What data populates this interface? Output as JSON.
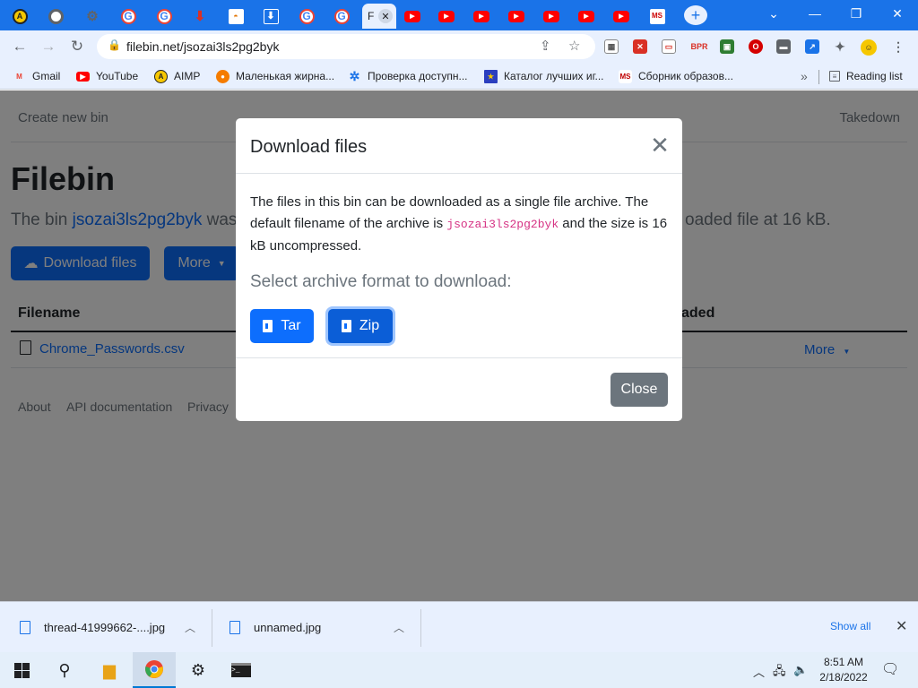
{
  "browser": {
    "active_tab_label": "F",
    "url": "filebin.net/jsozai3ls2pg2byk",
    "tab_icons": [
      "aimp-icon",
      "chromium-icon",
      "gear-icon",
      "google-icon",
      "google-icon",
      "red-arrow-icon",
      "image-icon",
      "download-icon",
      "google-icon",
      "google-icon"
    ],
    "youtube_tab_count": 7,
    "bookmarks": [
      {
        "label": "Gmail",
        "icon": "gmail-icon",
        "color": "#ea4335"
      },
      {
        "label": "YouTube",
        "icon": "youtube-icon",
        "color": "#ff0000"
      },
      {
        "label": "AIMP",
        "icon": "aimp-icon",
        "color": "#f6c700"
      },
      {
        "label": "Маленькая жирна...",
        "icon": "flame-icon",
        "color": "#f57c00"
      },
      {
        "label": "Проверка доступн...",
        "icon": "gear-icon",
        "color": "#1a73e8"
      },
      {
        "label": "Каталог лучших иг...",
        "icon": "flag-icon",
        "color": "#2b3fbf"
      },
      {
        "label": "Сборник образов...",
        "icon": "ms-icon",
        "color": "#c00000"
      }
    ],
    "reading_list": "Reading list"
  },
  "page": {
    "nav_left": "Create new bin",
    "nav_right": "Takedown",
    "title": "Filebin",
    "lead_prefix": "The bin",
    "bin_id": "jsozai3ls2pg2byk",
    "lead_after": "was",
    "lead_right": "oaded file at 16 kB.",
    "download_button": "Download files",
    "more_button": "More",
    "col_filename": "Filename",
    "col_uploaded": "aded",
    "file_name": "Chrome_Passwords.csv",
    "row_more": "More",
    "footer": [
      "About",
      "API documentation",
      "Privacy"
    ]
  },
  "modal": {
    "title": "Download files",
    "text_1": "The files in this bin can be downloaded as a single file archive. The default filename of the archive is",
    "archive_name": "jsozai3ls2pg2byk",
    "text_2": "and the size is 16 kB uncompressed.",
    "subtitle": "Select archive format to download:",
    "tar_button": "Tar",
    "zip_button": "Zip",
    "close_button": "Close"
  },
  "downloads": {
    "items": [
      "thread-41999662-....jpg",
      "unnamed.jpg"
    ],
    "show_all": "Show all"
  },
  "taskbar": {
    "time": "8:51 AM",
    "date": "2/18/2022"
  }
}
